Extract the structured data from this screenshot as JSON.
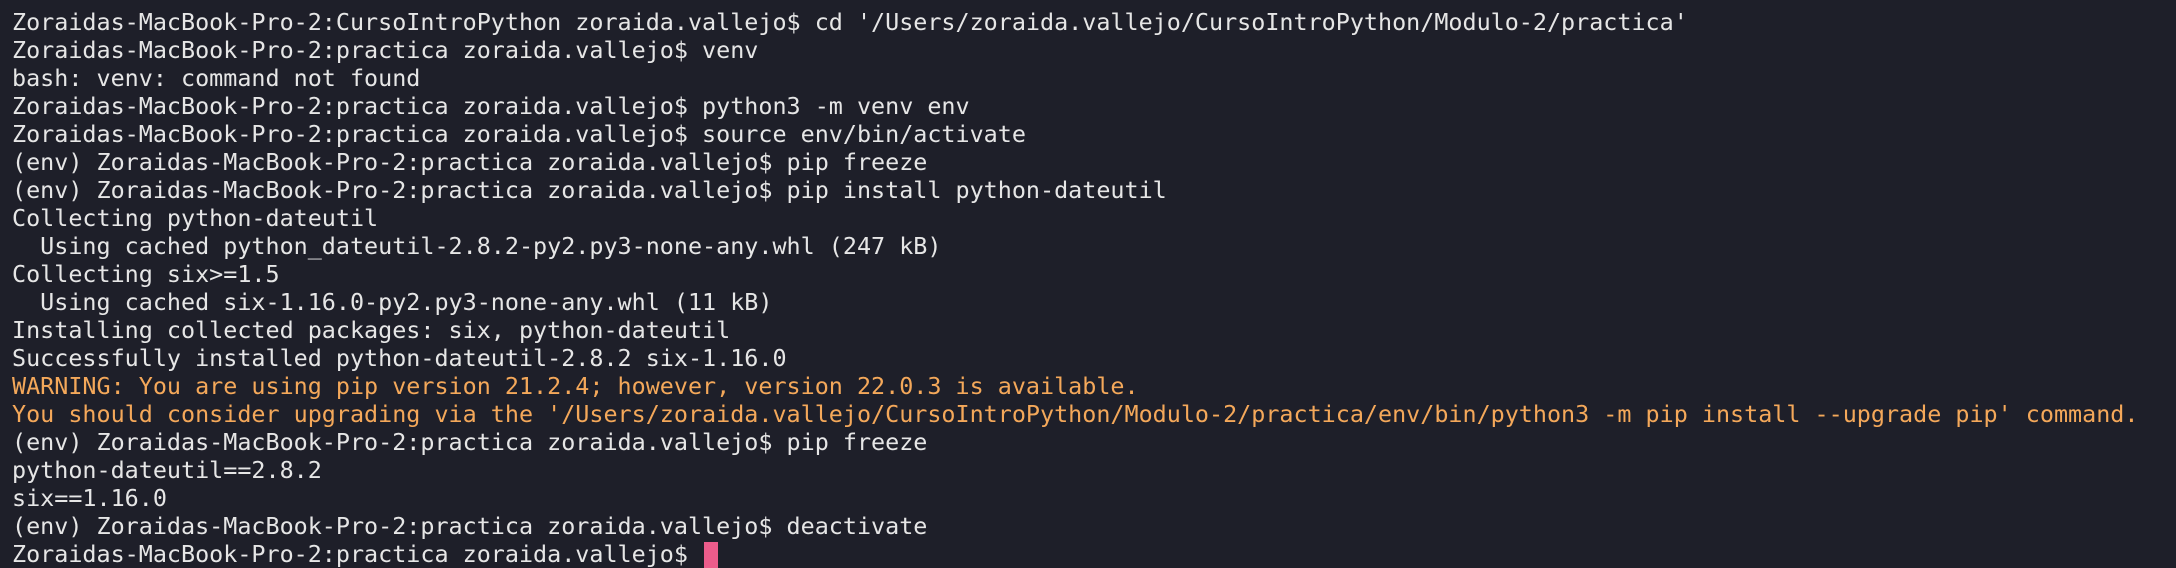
{
  "terminal": {
    "lines": [
      {
        "text": "Zoraidas-MacBook-Pro-2:CursoIntroPython zoraida.vallejo$ cd '/Users/zoraida.vallejo/CursoIntroPython/Modulo-2/practica'",
        "kind": "normal"
      },
      {
        "text": "Zoraidas-MacBook-Pro-2:practica zoraida.vallejo$ venv",
        "kind": "normal"
      },
      {
        "text": "bash: venv: command not found",
        "kind": "normal"
      },
      {
        "text": "Zoraidas-MacBook-Pro-2:practica zoraida.vallejo$ python3 -m venv env",
        "kind": "normal"
      },
      {
        "text": "Zoraidas-MacBook-Pro-2:practica zoraida.vallejo$ source env/bin/activate",
        "kind": "normal"
      },
      {
        "text": "(env) Zoraidas-MacBook-Pro-2:practica zoraida.vallejo$ pip freeze",
        "kind": "normal"
      },
      {
        "text": "(env) Zoraidas-MacBook-Pro-2:practica zoraida.vallejo$ pip install python-dateutil",
        "kind": "normal"
      },
      {
        "text": "Collecting python-dateutil",
        "kind": "normal"
      },
      {
        "text": "  Using cached python_dateutil-2.8.2-py2.py3-none-any.whl (247 kB)",
        "kind": "normal"
      },
      {
        "text": "Collecting six>=1.5",
        "kind": "normal"
      },
      {
        "text": "  Using cached six-1.16.0-py2.py3-none-any.whl (11 kB)",
        "kind": "normal"
      },
      {
        "text": "Installing collected packages: six, python-dateutil",
        "kind": "normal"
      },
      {
        "text": "Successfully installed python-dateutil-2.8.2 six-1.16.0",
        "kind": "normal"
      },
      {
        "text": "WARNING: You are using pip version 21.2.4; however, version 22.0.3 is available.",
        "kind": "warning"
      },
      {
        "text": "You should consider upgrading via the '/Users/zoraida.vallejo/CursoIntroPython/Modulo-2/practica/env/bin/python3 -m pip install --upgrade pip' command.",
        "kind": "warning"
      },
      {
        "text": "(env) Zoraidas-MacBook-Pro-2:practica zoraida.vallejo$ pip freeze",
        "kind": "normal"
      },
      {
        "text": "python-dateutil==2.8.2",
        "kind": "normal"
      },
      {
        "text": "six==1.16.0",
        "kind": "normal"
      },
      {
        "text": "(env) Zoraidas-MacBook-Pro-2:practica zoraida.vallejo$ deactivate",
        "kind": "normal"
      }
    ],
    "prompt": "Zoraidas-MacBook-Pro-2:practica zoraida.vallejo$ ",
    "colors": {
      "background": "#1e1f29",
      "text": "#e6e6e6",
      "warning": "#f4a85a",
      "cursor": "#ec5c8b"
    }
  }
}
